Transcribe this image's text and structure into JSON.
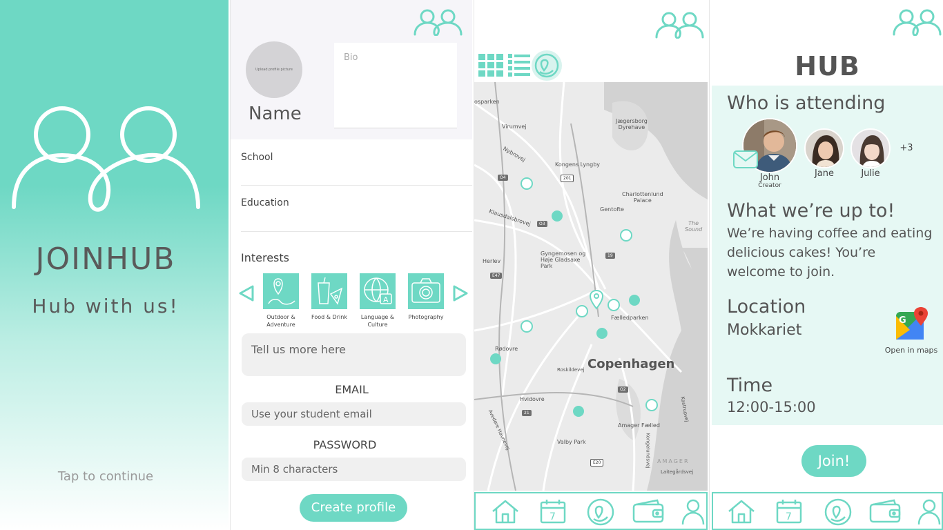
{
  "colors": {
    "accent": "#6ed8c4",
    "text": "#555555",
    "panel": "#e6f8f4"
  },
  "splash": {
    "brand": "JOINHUB",
    "tagline": "Hub with us!",
    "tap": "Tap to continue",
    "logo_icon": "two-people-icon"
  },
  "profile": {
    "avatar_hint": "Upload profile picture",
    "name": "Name",
    "bio_placeholder": "Bio",
    "school_label": "School",
    "education_label": "Education",
    "interests_label": "Interests",
    "interests": [
      {
        "label": "Outdoor & Adventure",
        "icon": "outdoor-icon"
      },
      {
        "label": "Food & Drink",
        "icon": "food-drink-icon"
      },
      {
        "label": "Language & Culture",
        "icon": "language-icon"
      },
      {
        "label": "Photography",
        "icon": "camera-icon"
      }
    ],
    "more_placeholder": "Tell us more here",
    "email_label": "EMAIL",
    "email_placeholder": "Use your student email",
    "password_label": "PASSWORD",
    "password_placeholder": "Min 8 characters",
    "create_button": "Create profile"
  },
  "map": {
    "labels": {
      "osparken": "osparken",
      "virumvej": "Virumvej",
      "nybrovej": "Nybrovej",
      "jaegersborg": "Jægersborg\nDyrehave",
      "kongens_lyngby": "Kongens Lyngby",
      "charlottenlund": "Charlottenlund\nPalace",
      "gentofte": "Gentofte",
      "klausdals": "Klausdalsbrovej",
      "the_sound": "The\nSound",
      "gyngemosen": "Gyngemosen og\nHøje Gladsaxe\nPark",
      "herlev": "Herlev",
      "faelledparken": "Fælledparken",
      "rodovre": "Rødovre",
      "copenhagen": "Copenhagen",
      "roskildevej": "Roskildevej",
      "hvidovre": "Hvidovre",
      "avedore": "Avedøre Havnevej",
      "valby": "Valby Park",
      "amager": "Amager Fælled",
      "amager_big": "AMAGER",
      "laitegaardsvej": "Laitegårdsvej",
      "kongelundsvej": "Kongelundsvej",
      "kastrupvej": "Kastrupvej"
    },
    "badges": {
      "o4": "O4",
      "r201": "201",
      "o3": "O3",
      "r19": "19",
      "e47": "E47",
      "o2": "O2",
      "r21": "21",
      "e20": "E20"
    }
  },
  "tabs": [
    {
      "name": "home",
      "icon": "home-icon"
    },
    {
      "name": "calendar",
      "icon": "calendar-icon",
      "day": "7"
    },
    {
      "name": "map",
      "icon": "map-pin-icon"
    },
    {
      "name": "wallet",
      "icon": "wallet-icon"
    },
    {
      "name": "profile",
      "icon": "person-icon"
    }
  ],
  "hub": {
    "title": "HUB",
    "attending_heading": "Who is attending",
    "attendees": [
      {
        "name": "John",
        "role": "Creator"
      },
      {
        "name": "Jane"
      },
      {
        "name": "Julie"
      }
    ],
    "more_count": "+3",
    "upto_heading": "What we’re up to!",
    "description": "We’re having coffee and eating delicious cakes! You’re welcome to join.",
    "location_heading": "Location",
    "location_value": "Mokkariet",
    "open_maps": "Open in maps",
    "time_heading": "Time",
    "time_value": "12:00-15:00",
    "join_button": "Join!"
  }
}
